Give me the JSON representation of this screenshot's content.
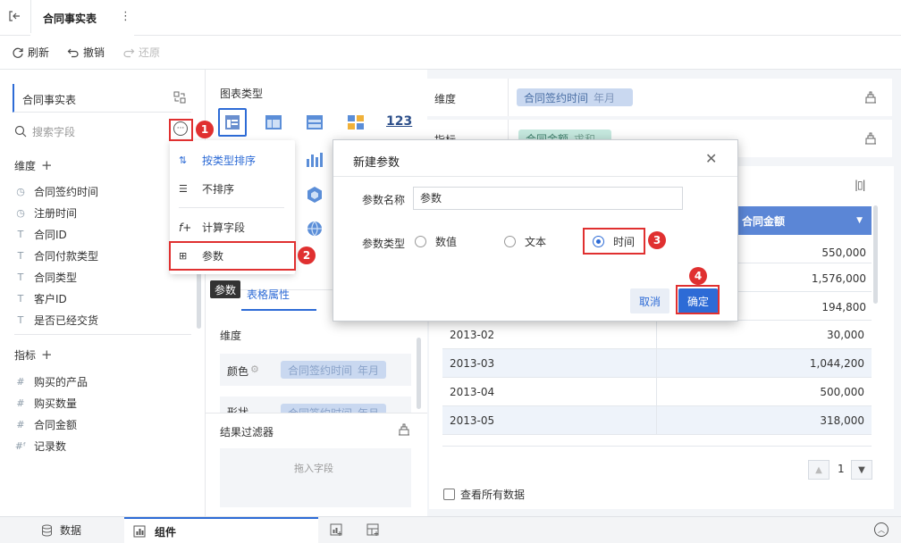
{
  "topbar": {
    "title": "合同事实表",
    "more": "⋮"
  },
  "toolbar": {
    "refresh": "刷新",
    "undo": "撤销",
    "redo": "还原"
  },
  "left": {
    "table_name": "合同事实表",
    "search_placeholder": "搜索字段",
    "dimension_title": "维度",
    "dimensions": [
      "合同签约时间",
      "注册时间",
      "合同ID",
      "合同付款类型",
      "合同类型",
      "客户ID",
      "是否已经交货"
    ],
    "measure_title": "指标",
    "measures": [
      "购买的产品",
      "购买数量",
      "合同金额",
      "记录数"
    ]
  },
  "menu": {
    "items": [
      "按类型排序",
      "不排序",
      "计算字段",
      "参数"
    ]
  },
  "badges": {
    "b1": "1",
    "b2": "2",
    "b3": "3",
    "b4": "4"
  },
  "mid": {
    "chart_type_title": "图表类型",
    "tooltip": "参数",
    "tab_table_props": "表格属性",
    "dimension_title": "维度",
    "color_label": "颜色",
    "color_chip": "合同签约时间",
    "color_chip_unit": "年月",
    "shape_label": "形状",
    "shape_chip": "合同签约时间",
    "shape_chip_unit": "年月",
    "filter_title": "结果过滤器",
    "drop_hint": "拖入字段",
    "chart_num_label": "123"
  },
  "right": {
    "dim_label": "维度",
    "dim_chip": "合同签约时间",
    "dim_chip_unit": "年月",
    "measure_label": "指标",
    "measure_chip": "合同金额",
    "measure_chip_unit": "求和",
    "col_header": "合同金额",
    "values_top": [
      "550,000",
      "1,576,000",
      "194,800"
    ],
    "rows": [
      {
        "date": "2013-02",
        "value": "30,000"
      },
      {
        "date": "2013-03",
        "value": "1,044,200"
      },
      {
        "date": "2013-04",
        "value": "500,000"
      },
      {
        "date": "2013-05",
        "value": "318,000"
      }
    ],
    "page_num": "1",
    "view_all": "查看所有数据"
  },
  "dialog": {
    "title": "新建参数",
    "name_label": "参数名称",
    "name_value": "参数",
    "type_label": "参数类型",
    "opt_number": "数值",
    "opt_text": "文本",
    "opt_time": "时间",
    "cancel": "取消",
    "ok": "确定"
  },
  "bottombar": {
    "data_tab": "数据",
    "component_tab": "组件"
  },
  "colors": {
    "accent": "#2d6bd6",
    "red": "#e03030",
    "chip_blue": "#c9d8f0",
    "chip_green": "#c5e8de"
  }
}
